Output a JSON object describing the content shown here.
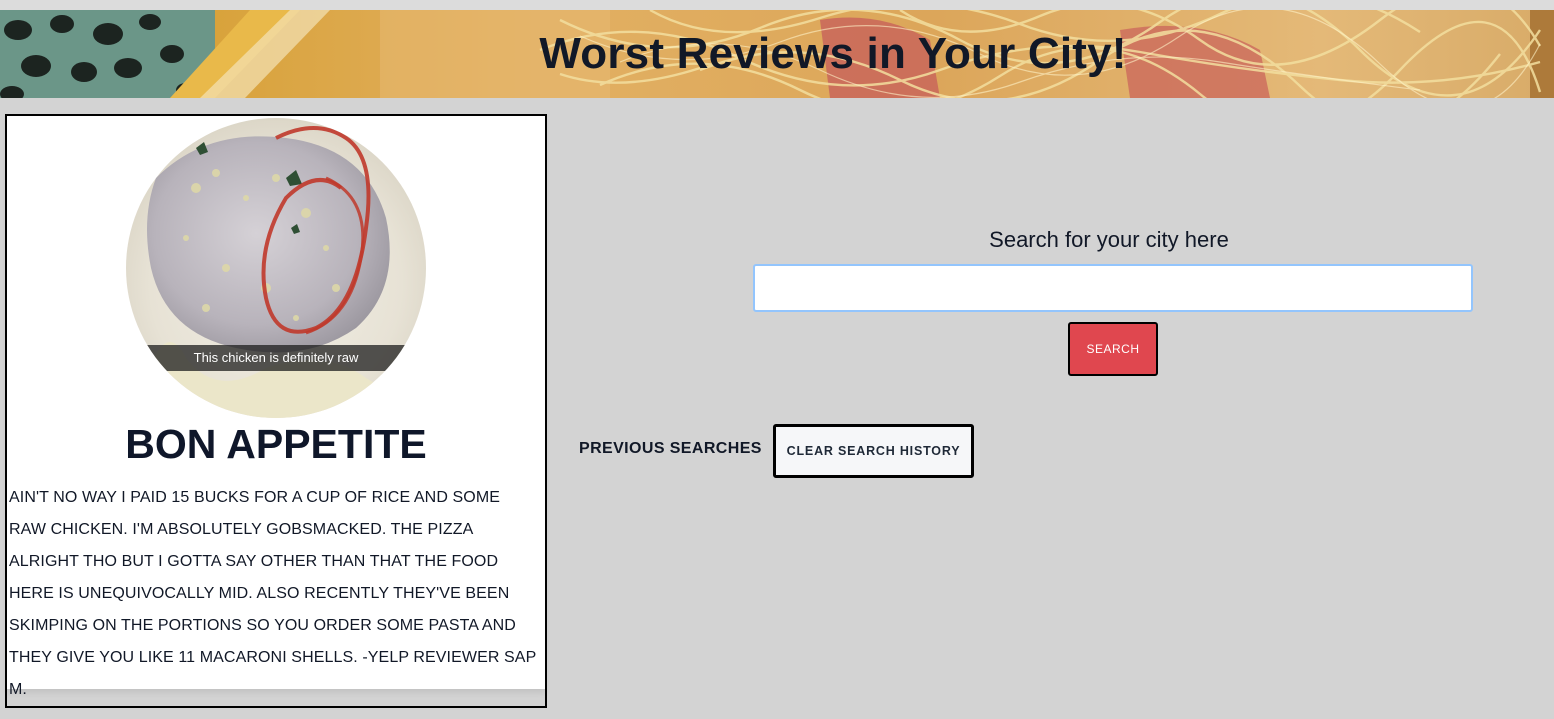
{
  "header": {
    "title": "Worst Reviews in Your City!"
  },
  "featured_review": {
    "photo_caption": "This chicken is definitely raw",
    "restaurant_name": "BON APPETITE",
    "review_text": "AIN'T NO WAY I PAID 15 BUCKS FOR A CUP OF RICE AND SOME RAW CHICKEN. I'M ABSOLUTELY GOBSMACKED. THE PIZZA ALRIGHT THO BUT I GOTTA SAY OTHER THAN THAT THE FOOD HERE IS UNEQUIVOCALLY MID. ALSO RECENTLY THEY'VE BEEN SKIMPING ON THE PORTIONS SO YOU ORDER SOME PASTA AND THEY GIVE YOU LIKE 11 MACARONI SHELLS. -YELP REVIEWER SAP M."
  },
  "search": {
    "label": "Search for your city here",
    "input_value": "",
    "placeholder": "",
    "button_label": "SEARCH"
  },
  "history": {
    "label": "PREVIOUS SEARCHES",
    "clear_button_label": "CLEAR SEARCH HISTORY",
    "items": []
  },
  "colors": {
    "page_background": "#d3d3d3",
    "search_button": "#e0474f",
    "input_focus_border": "#93c5fd"
  }
}
